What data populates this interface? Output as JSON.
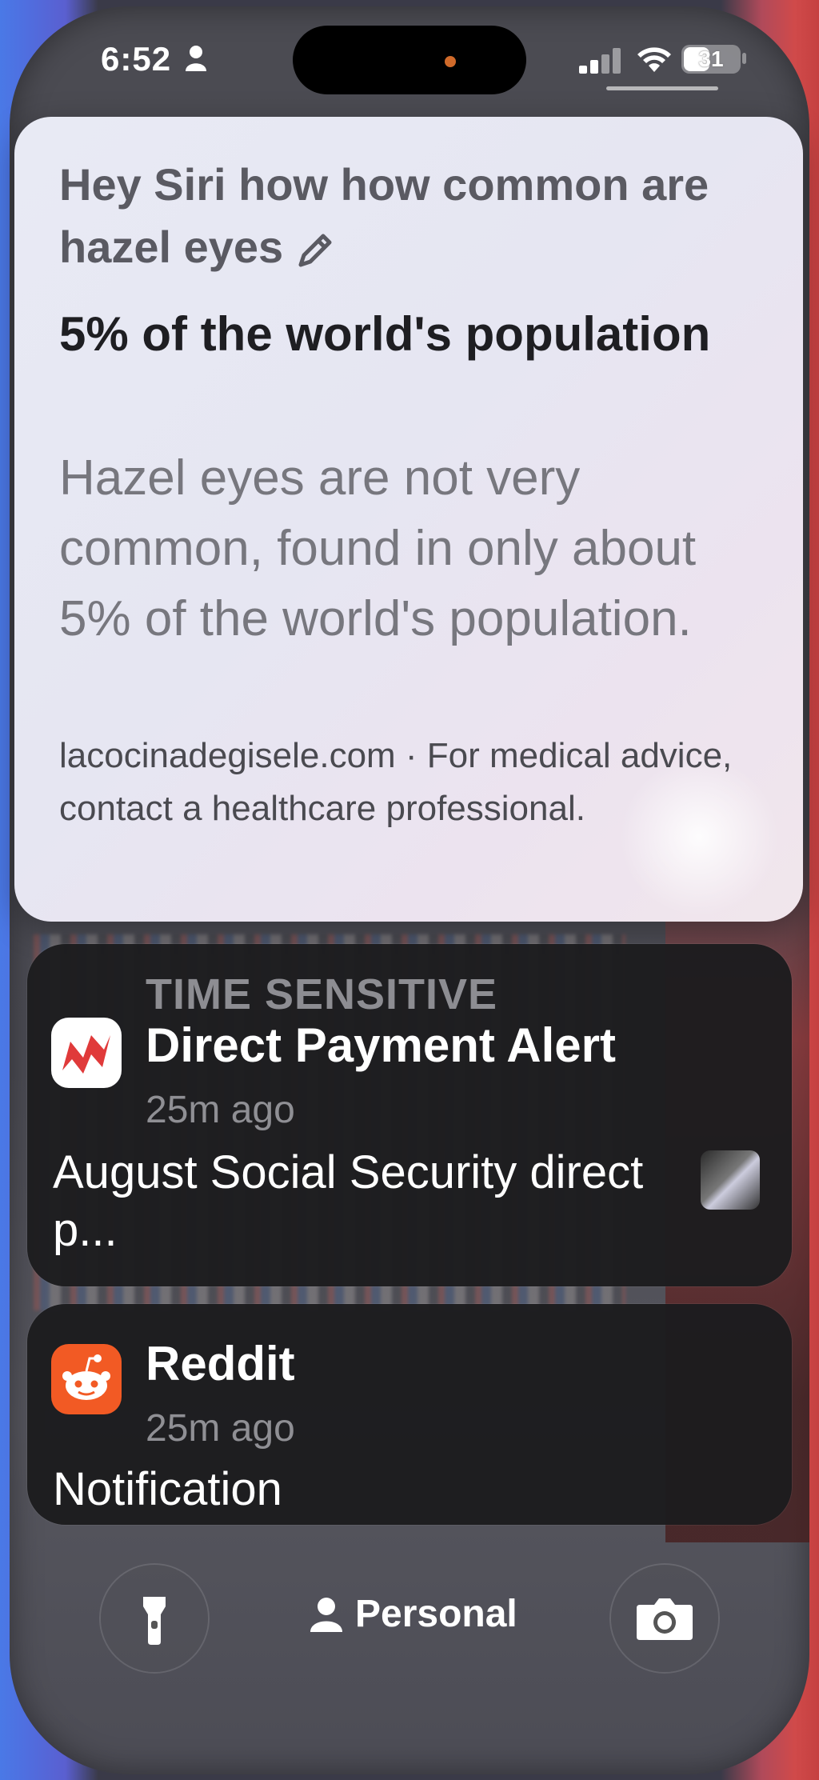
{
  "status_bar": {
    "time": "6:52",
    "battery": "31"
  },
  "siri": {
    "query": "Hey Siri how how common are hazel eyes",
    "answer": "5% of the world's population",
    "detail": "Hazel eyes are not very common, found in only about 5% of the world's population.",
    "source": "lacocinadegisele.com · For medical advice, contact a healthcare professional."
  },
  "notifications": [
    {
      "label": "TIME SENSITIVE",
      "app": "Direct Payment Alert",
      "time": "25m ago",
      "body": "August Social Security direct p..."
    },
    {
      "app": "Reddit",
      "time": "25m ago",
      "body": "Notification"
    }
  ],
  "lockscreen": {
    "focus_label": "Personal"
  },
  "icons": {
    "status": [
      "person-icon",
      "cellular-signal-icon",
      "wifi-icon",
      "battery-icon"
    ],
    "siri": [
      "pencil-icon"
    ],
    "apps": [
      "direct-payment-alert-app-icon",
      "reddit-app-icon"
    ],
    "bottom": [
      "flashlight-icon",
      "person-icon",
      "camera-icon"
    ]
  },
  "colors": {
    "reddit_orange": "#f25a24",
    "alert_red": "#e03a3a",
    "notification_bg": "#1c1c1e"
  }
}
